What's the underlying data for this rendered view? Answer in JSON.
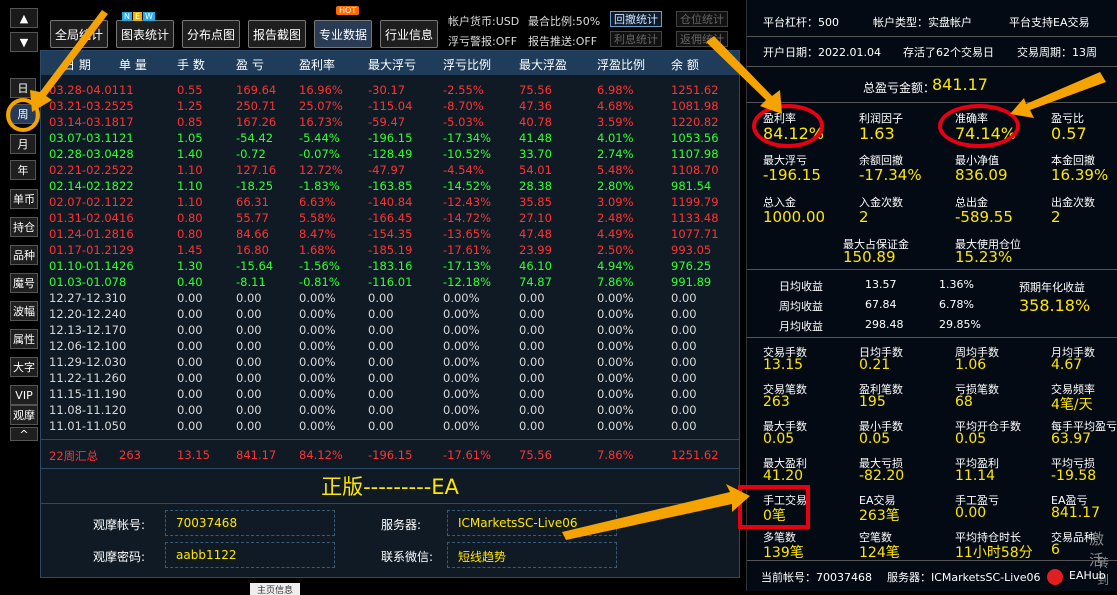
{
  "nav": {
    "up": "▲",
    "down": "▼"
  },
  "period_tabs": [
    "日",
    "周",
    "月",
    "年"
  ],
  "side_buttons": [
    "单币",
    "持仓",
    "品种",
    "魔号",
    "波幅",
    "属性",
    "大字",
    "VIP",
    "观摩",
    "^"
  ],
  "toolbar": {
    "buttons": [
      "全局统计",
      "图表统计",
      "分布点图",
      "报告截图",
      "专业数据",
      "行业信息"
    ],
    "new_badge": "NEW",
    "hot_badge": "HOT",
    "currency": "帐户货币:USD",
    "max_ratio": "最合比例:50%",
    "float_warn": "浮亏警报:OFF",
    "report_push": "报告推送:OFF",
    "btn_recall": "回撤统计",
    "btn_position": "仓位统计",
    "btn_interest": "利息统计",
    "btn_rebate": "返佣统计"
  },
  "table": {
    "headers": [
      "日 期",
      "单 量",
      "手 数",
      "盈 亏",
      "盈利率",
      "最大浮亏",
      "浮亏比例",
      "最大浮盈",
      "浮盈比例",
      "余 额"
    ],
    "rows": [
      [
        "03.28-04.01",
        "11",
        "0.55",
        "169.64",
        "16.96%",
        "-30.17",
        "-2.55%",
        "75.56",
        "6.98%",
        "1251.62"
      ],
      [
        "03.21-03.25",
        "25",
        "1.25",
        "250.71",
        "25.07%",
        "-115.04",
        "-8.70%",
        "47.36",
        "4.68%",
        "1081.98"
      ],
      [
        "03.14-03.18",
        "17",
        "0.85",
        "167.26",
        "16.73%",
        "-59.47",
        "-5.03%",
        "40.78",
        "3.59%",
        "1220.82"
      ],
      [
        "03.07-03.11",
        "21",
        "1.05",
        "-54.42",
        "-5.44%",
        "-196.15",
        "-17.34%",
        "41.48",
        "4.01%",
        "1053.56"
      ],
      [
        "02.28-03.04",
        "28",
        "1.40",
        "-0.72",
        "-0.07%",
        "-128.49",
        "-10.52%",
        "33.70",
        "2.74%",
        "1107.98"
      ],
      [
        "02.21-02.25",
        "22",
        "1.10",
        "127.16",
        "12.72%",
        "-47.97",
        "-4.54%",
        "54.01",
        "5.48%",
        "1108.70"
      ],
      [
        "02.14-02.18",
        "22",
        "1.10",
        "-18.25",
        "-1.83%",
        "-163.85",
        "-14.52%",
        "28.38",
        "2.80%",
        "981.54"
      ],
      [
        "02.07-02.11",
        "22",
        "1.10",
        "66.31",
        "6.63%",
        "-140.84",
        "-12.43%",
        "35.85",
        "3.09%",
        "1199.79"
      ],
      [
        "01.31-02.04",
        "16",
        "0.80",
        "55.77",
        "5.58%",
        "-166.45",
        "-14.72%",
        "27.10",
        "2.48%",
        "1133.48"
      ],
      [
        "01.24-01.28",
        "16",
        "0.80",
        "84.66",
        "8.47%",
        "-154.35",
        "-13.65%",
        "47.48",
        "4.49%",
        "1077.71"
      ],
      [
        "01.17-01.21",
        "29",
        "1.45",
        "16.80",
        "1.68%",
        "-185.19",
        "-17.61%",
        "23.99",
        "2.50%",
        "993.05"
      ],
      [
        "01.10-01.14",
        "26",
        "1.30",
        "-15.64",
        "-1.56%",
        "-183.16",
        "-17.13%",
        "46.10",
        "4.94%",
        "976.25"
      ],
      [
        "01.03-01.07",
        "8",
        "0.40",
        "-8.11",
        "-0.81%",
        "-116.01",
        "-12.18%",
        "74.87",
        "7.86%",
        "991.89"
      ],
      [
        "12.27-12.31",
        "0",
        "0.00",
        "0.00",
        "0.00%",
        "0.00",
        "0.00%",
        "0.00",
        "0.00%",
        "0.00"
      ],
      [
        "12.20-12.24",
        "0",
        "0.00",
        "0.00",
        "0.00%",
        "0.00",
        "0.00%",
        "0.00",
        "0.00%",
        "0.00"
      ],
      [
        "12.13-12.17",
        "0",
        "0.00",
        "0.00",
        "0.00%",
        "0.00",
        "0.00%",
        "0.00",
        "0.00%",
        "0.00"
      ],
      [
        "12.06-12.10",
        "0",
        "0.00",
        "0.00",
        "0.00%",
        "0.00",
        "0.00%",
        "0.00",
        "0.00%",
        "0.00"
      ],
      [
        "11.29-12.03",
        "0",
        "0.00",
        "0.00",
        "0.00%",
        "0.00",
        "0.00%",
        "0.00",
        "0.00%",
        "0.00"
      ],
      [
        "11.22-11.26",
        "0",
        "0.00",
        "0.00",
        "0.00%",
        "0.00",
        "0.00%",
        "0.00",
        "0.00%",
        "0.00"
      ],
      [
        "11.15-11.19",
        "0",
        "0.00",
        "0.00",
        "0.00%",
        "0.00",
        "0.00%",
        "0.00",
        "0.00%",
        "0.00"
      ],
      [
        "11.08-11.12",
        "0",
        "0.00",
        "0.00",
        "0.00%",
        "0.00",
        "0.00%",
        "0.00",
        "0.00%",
        "0.00"
      ],
      [
        "11.01-11.05",
        "0",
        "0.00",
        "0.00",
        "0.00%",
        "0.00",
        "0.00%",
        "0.00",
        "0.00%",
        "0.00"
      ]
    ],
    "row_colors": [
      "red",
      "red",
      "red",
      "green",
      "green",
      "red",
      "green",
      "red",
      "red",
      "red",
      "red",
      "green",
      "green",
      "gray",
      "gray",
      "gray",
      "gray",
      "gray",
      "gray",
      "gray",
      "gray",
      "gray"
    ],
    "summary": [
      "22周汇总",
      "263",
      "13.15",
      "841.17",
      "84.12%",
      "-196.15",
      "-17.61%",
      "75.56",
      "7.86%",
      "1251.62"
    ]
  },
  "banner": "正版---------EA",
  "account": {
    "watch_acct_label": "观摩帐号:",
    "watch_acct_value": "70037468",
    "server_label": "服务器:",
    "server_value": "ICMarketsSC-Live06",
    "watch_pwd_label": "观摩密码:",
    "watch_pwd_value": "aabb1122",
    "contact_label": "联系微信:",
    "contact_value": "短线趋势"
  },
  "bottom_tab": "主页信息",
  "right": {
    "leverage": "平台杠杆：500",
    "acct_type": "帐户类型：实盘帐户",
    "ea_support": "平台支持EA交易",
    "open_date": "开户日期：2022.01.04",
    "days": "存活了62个交易日",
    "period": "交易周期：13周",
    "total_label": "总盈亏金额：",
    "total_value": "841.17",
    "stats": [
      {
        "label": "盈利率",
        "value": "84.12%"
      },
      {
        "label": "利润因子",
        "value": "1.63"
      },
      {
        "label": "准确率",
        "value": "74.14%"
      },
      {
        "label": "盈亏比",
        "value": "0.57"
      },
      {
        "label": "最大浮亏",
        "value": "-196.15"
      },
      {
        "label": "余额回撤",
        "value": "-17.34%"
      },
      {
        "label": "最小净值",
        "value": "836.09"
      },
      {
        "label": "本金回撤",
        "value": "16.39%"
      },
      {
        "label": "总入金",
        "value": "1000.00"
      },
      {
        "label": "入金次数",
        "value": "2"
      },
      {
        "label": "总出金",
        "value": "-589.55"
      },
      {
        "label": "出金次数",
        "value": "2"
      }
    ],
    "margin": [
      {
        "label": "最大占保证金",
        "value": "150.89"
      },
      {
        "label": "最大使用仓位",
        "value": "15.23%"
      }
    ],
    "avg": [
      {
        "label": "日均收益",
        "v1": "13.57",
        "v2": "1.36%"
      },
      {
        "label": "周均收益",
        "v1": "67.84",
        "v2": "6.78%"
      },
      {
        "label": "月均收益",
        "v1": "298.48",
        "v2": "29.85%"
      }
    ],
    "annual_label": "预期年化收益",
    "annual_value": "358.18%",
    "trade": [
      {
        "label": "交易手数",
        "value": "13.15"
      },
      {
        "label": "日均手数",
        "value": "0.21"
      },
      {
        "label": "周均手数",
        "value": "1.06"
      },
      {
        "label": "月均手数",
        "value": "4.67"
      },
      {
        "label": "交易笔数",
        "value": "263"
      },
      {
        "label": "盈利笔数",
        "value": "195"
      },
      {
        "label": "亏损笔数",
        "value": "68"
      },
      {
        "label": "交易频率",
        "value": "4笔/天"
      },
      {
        "label": "最大手数",
        "value": "0.05"
      },
      {
        "label": "最小手数",
        "value": "0.05"
      },
      {
        "label": "平均开仓手数",
        "value": "0.05"
      },
      {
        "label": "每手平均盈亏",
        "value": "63.97"
      },
      {
        "label": "最大盈利",
        "value": "41.20"
      },
      {
        "label": "最大亏损",
        "value": "-82.20"
      },
      {
        "label": "平均盈利",
        "value": "11.14"
      },
      {
        "label": "平均亏损",
        "value": "-19.58"
      },
      {
        "label": "手工交易",
        "value": "0笔"
      },
      {
        "label": "EA交易",
        "value": "263笔"
      },
      {
        "label": "手工盈亏",
        "value": "0.00"
      },
      {
        "label": "EA盈亏",
        "value": "841.17"
      },
      {
        "label": "多笔数",
        "value": "139笔"
      },
      {
        "label": "空笔数",
        "value": "124笔"
      },
      {
        "label": "平均持仓时长",
        "value": "11小时58分"
      },
      {
        "label": "交易品种",
        "value": "6"
      }
    ],
    "footer_acct": "当前帐号：70037468",
    "footer_server": "服务器：ICMarketsSC-Live06",
    "watermark_1": "激活",
    "watermark_2": "转到",
    "logo_text": "EAHub"
  },
  "colors": {
    "highlight": "#e60012",
    "arrow": "#f5a300",
    "value": "#ffe600",
    "header": "#1f3c5a"
  }
}
